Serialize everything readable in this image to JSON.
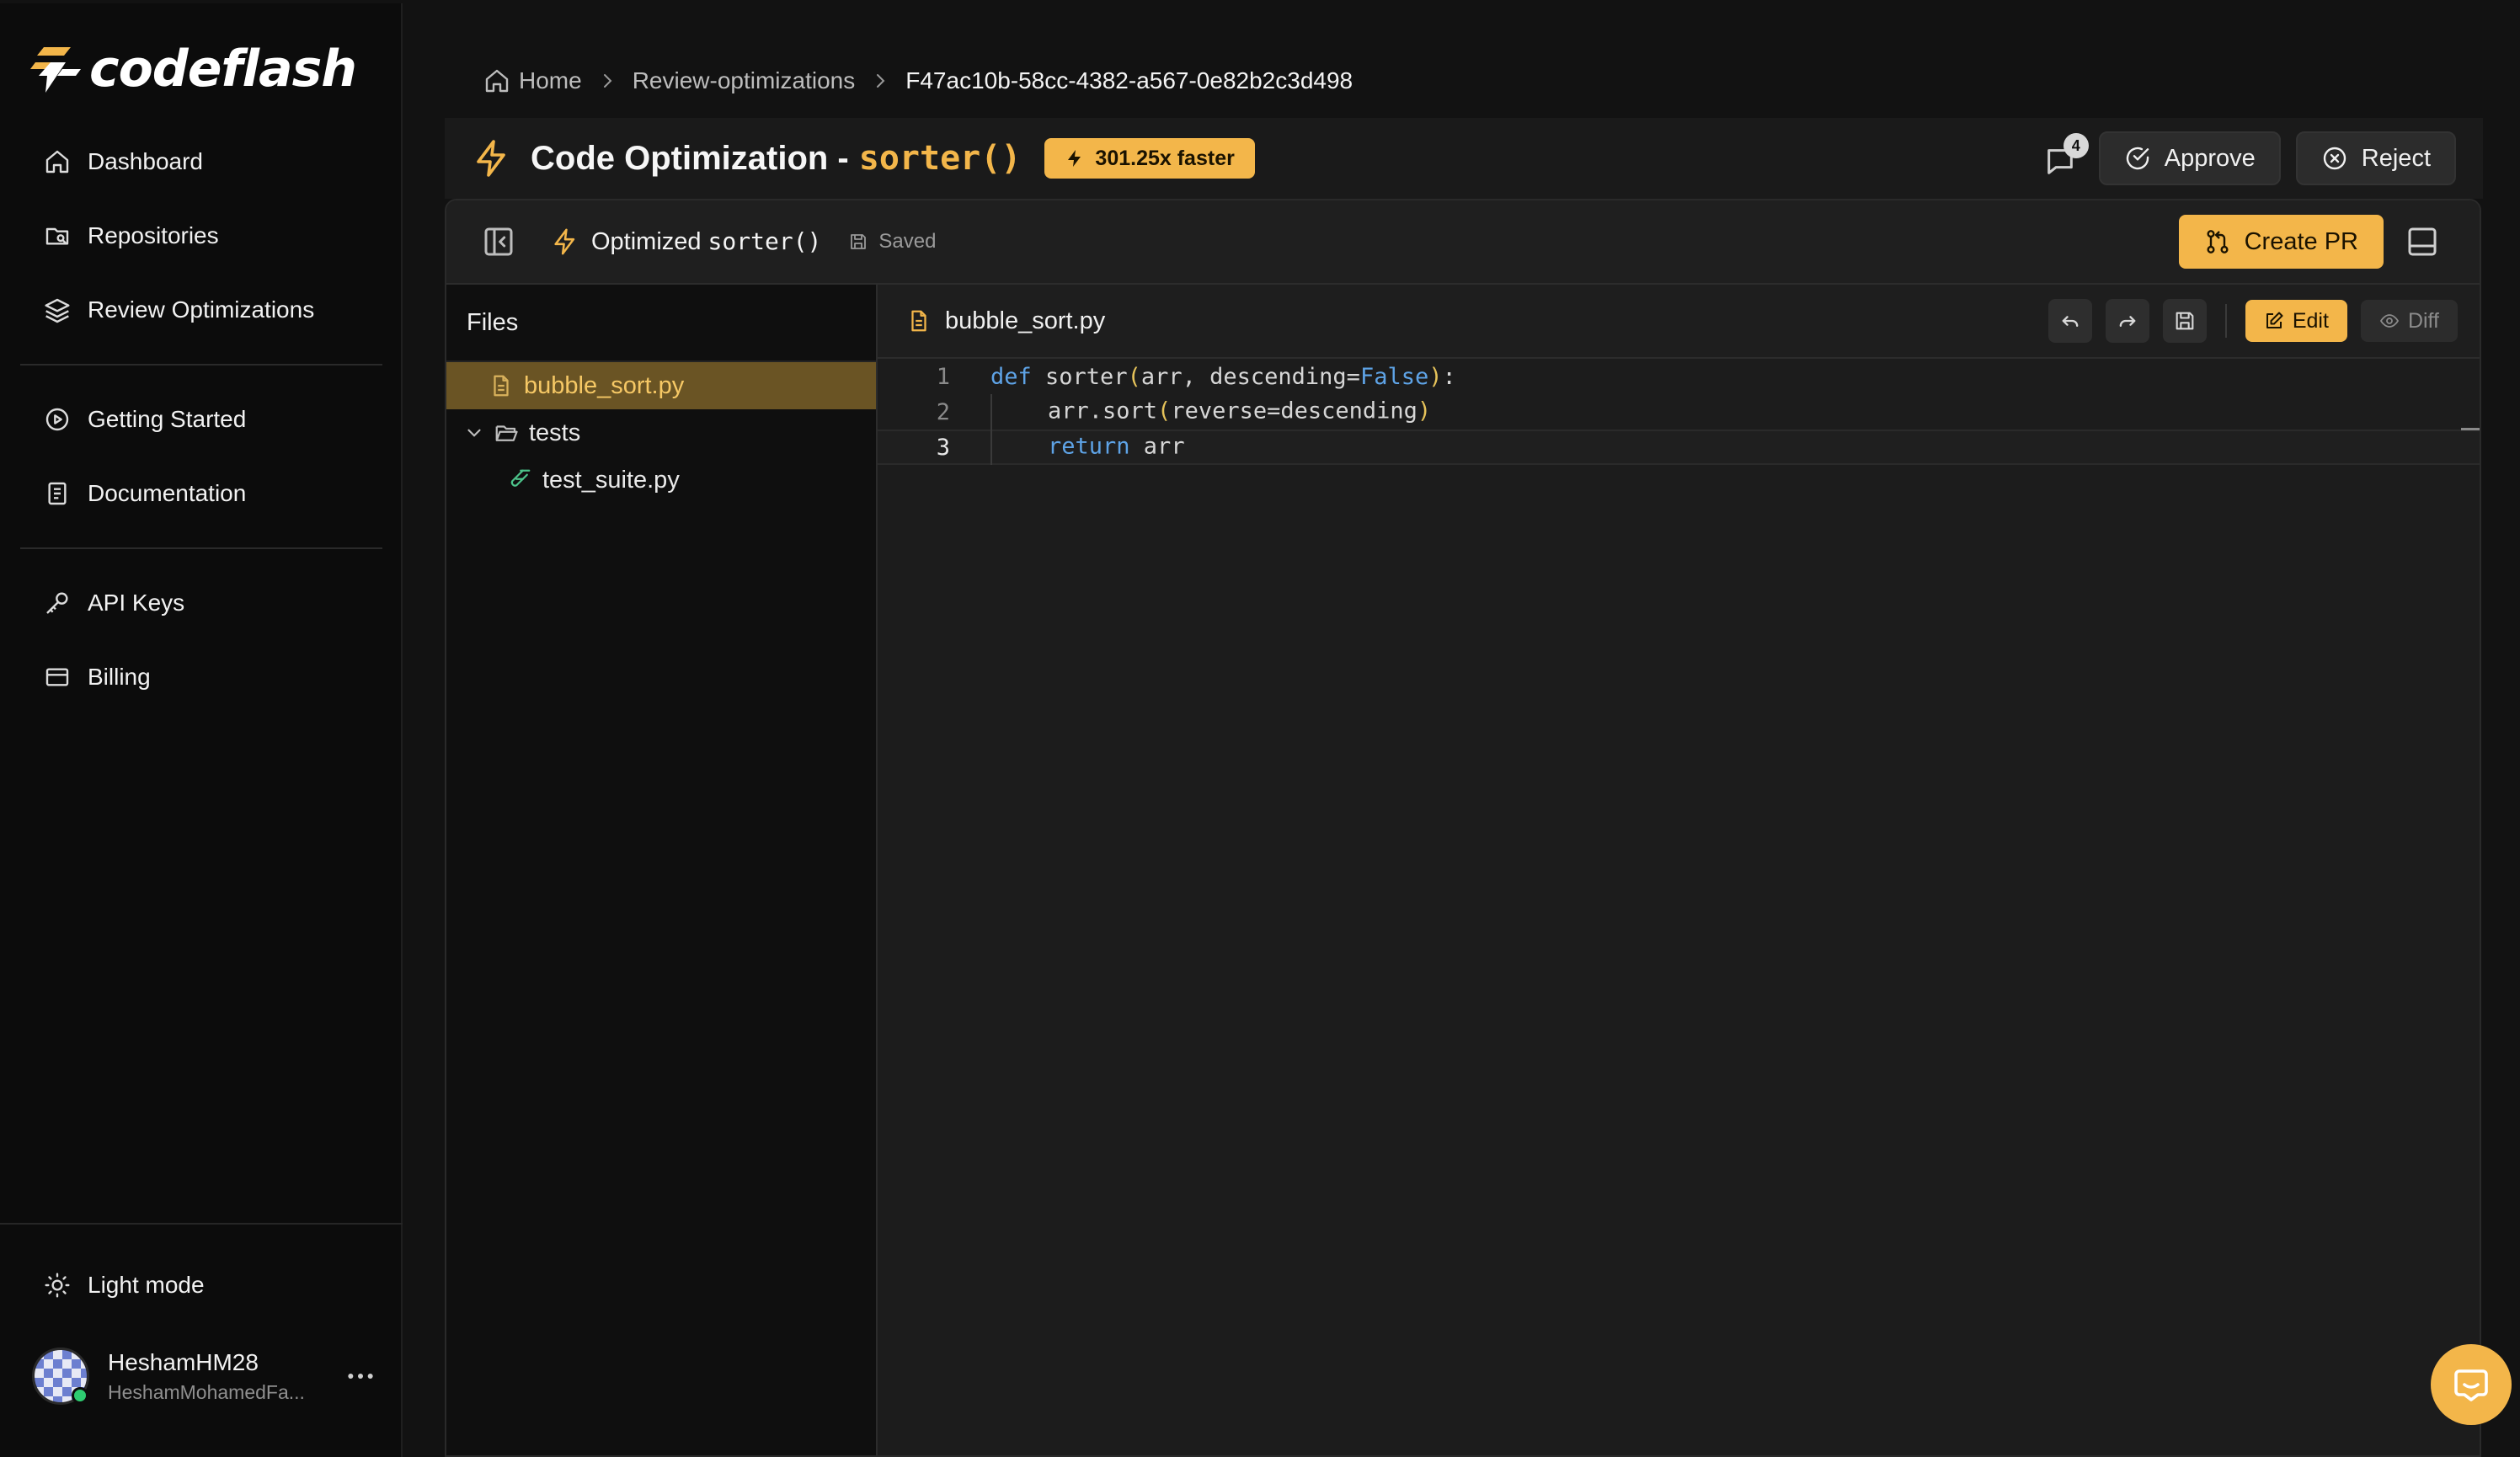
{
  "app": {
    "name": "codeflash"
  },
  "sidebar": {
    "nav_primary": [
      {
        "label": "Dashboard",
        "icon": "home-icon"
      },
      {
        "label": "Repositories",
        "icon": "repository-icon"
      },
      {
        "label": "Review Optimizations",
        "icon": "layers-icon"
      }
    ],
    "nav_secondary": [
      {
        "label": "Getting Started",
        "icon": "play-circle-icon"
      },
      {
        "label": "Documentation",
        "icon": "book-icon"
      }
    ],
    "nav_tertiary": [
      {
        "label": "API Keys",
        "icon": "key-icon"
      },
      {
        "label": "Billing",
        "icon": "credit-card-icon"
      }
    ],
    "light_mode_label": "Light mode",
    "user": {
      "name": "HeshamHM28",
      "email": "HeshamMohamedFa...",
      "status": "online"
    }
  },
  "breadcrumb": {
    "home": "Home",
    "section": "Review-optimizations",
    "current": "F47ac10b-58cc-4382-a567-0e82b2c3d498"
  },
  "header": {
    "title": "Code Optimization -",
    "function_name": "sorter()",
    "speedup_badge": "301.25x faster",
    "comment_count": "4",
    "approve_label": "Approve",
    "reject_label": "Reject"
  },
  "toolbar": {
    "title": "Optimized",
    "function_name": "sorter()",
    "saved_label": "Saved",
    "create_pr_label": "Create PR"
  },
  "files": {
    "header": "Files",
    "tree": {
      "file_1": "bubble_sort.py",
      "folder_1": "tests",
      "file_2": "test_suite.py"
    }
  },
  "editor": {
    "file_name": "bubble_sort.py",
    "edit_label": "Edit",
    "diff_label": "Diff",
    "line_numbers": [
      "1",
      "2",
      "3"
    ],
    "current_line": 3,
    "code": {
      "l1_kw": "def",
      "l1_a": " sorter",
      "l1_open": "(",
      "l1_b": "arr, descending=",
      "l1_false": "False",
      "l1_close": ")",
      "l1_colon": ":",
      "l2_a": "arr.sort",
      "l2_open": "(",
      "l2_b": "reverse=descending",
      "l2_close": ")",
      "l3_kw": "return",
      "l3_a": " arr"
    }
  },
  "colors": {
    "accent": "#f3b64a",
    "background": "#121212",
    "sidebar": "#0c0c0c",
    "active_file": "#6a5424",
    "keyword": "#5ea3e6"
  }
}
